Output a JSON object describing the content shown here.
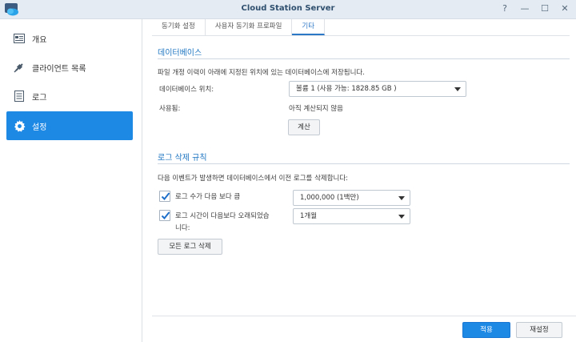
{
  "window": {
    "title": "Cloud Station Server",
    "controls": [
      "?",
      "—",
      "☐",
      "✕"
    ]
  },
  "sidebar": {
    "items": [
      {
        "label": "개요",
        "icon": "overview-icon"
      },
      {
        "label": "클라이언트 목록",
        "icon": "plug-icon"
      },
      {
        "label": "로그",
        "icon": "log-icon"
      },
      {
        "label": "설정",
        "icon": "gear-icon",
        "active": true
      }
    ]
  },
  "tabs": [
    "동기화 설정",
    "사용자 동기화 프로파일",
    "기타"
  ],
  "database": {
    "title": "데이터베이스",
    "description": "파일 개정 이력이 아래에 지정된 위치에 있는 데이터베이스에 저장됩니다.",
    "location_label": "데이터베이스 위치:",
    "location_value": "볼륨 1 (사용 가능: 1828.85 GB )",
    "used_label": "사용됨:",
    "used_value": "아직 계산되지 않음",
    "calculate_button": "계산"
  },
  "log_rules": {
    "title": "로그 삭제 규칙",
    "description": "다음 이벤트가 발생하면 데이터베이스에서 이전 로그를 삭제합니다:",
    "rule1_label": "로그 수가 다음 보다 큼",
    "rule1_checked": true,
    "rule1_value": "1,000,000 (1백만)",
    "rule2_label_line1": "로그 시간이 다음보다 오래되었습",
    "rule2_label_line2": "니다:",
    "rule2_checked": true,
    "rule2_value": "1개월",
    "delete_all_button": "모든 로그 삭제"
  },
  "footer": {
    "apply_button": "적용",
    "reset_button": "재설정"
  },
  "colors": {
    "accent": "#1e88e5",
    "section_title": "#1f76c2"
  }
}
